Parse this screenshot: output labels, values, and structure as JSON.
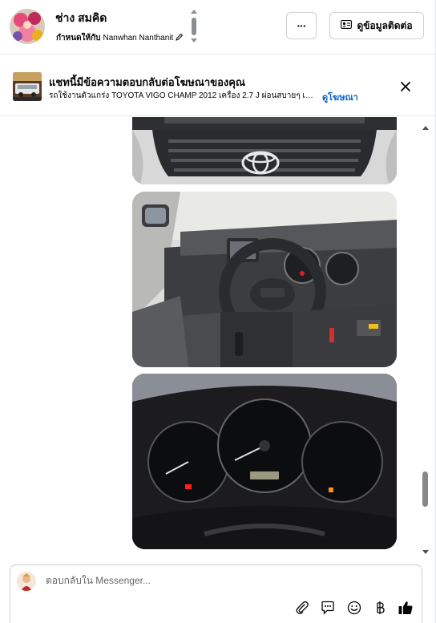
{
  "header": {
    "contact_name": "ช่าง สมคิด",
    "assign_prefix": "กำหนดให้กับ",
    "assignee": "Nanwhan Nanthanit",
    "more_label": "···",
    "contact_info_label": "ดูข้อมูลติดต่อ"
  },
  "ad_banner": {
    "title": "แชทนี้มีข้อความตอบกลับต่อโฆษณาของคุณ",
    "subtitle": "รถใช้งานตัวแกร่ง TOYOTA VIGO CHAMP 2012 เครื่อง 2.7 J ผ่อนสบายๆ เริ่...",
    "link": "ดูโฆษณา"
  },
  "composer": {
    "placeholder": "ตอบกลับใน Messenger..."
  },
  "icons": {
    "attach": "paperclip-icon",
    "saved_reply": "chat-bubble-icon",
    "emoji": "emoji-icon",
    "payment": "baht-icon",
    "like": "thumbs-up-icon"
  },
  "colors": {
    "accent": "#0a62c9",
    "border": "#ccd0d5",
    "like": "#050505"
  }
}
